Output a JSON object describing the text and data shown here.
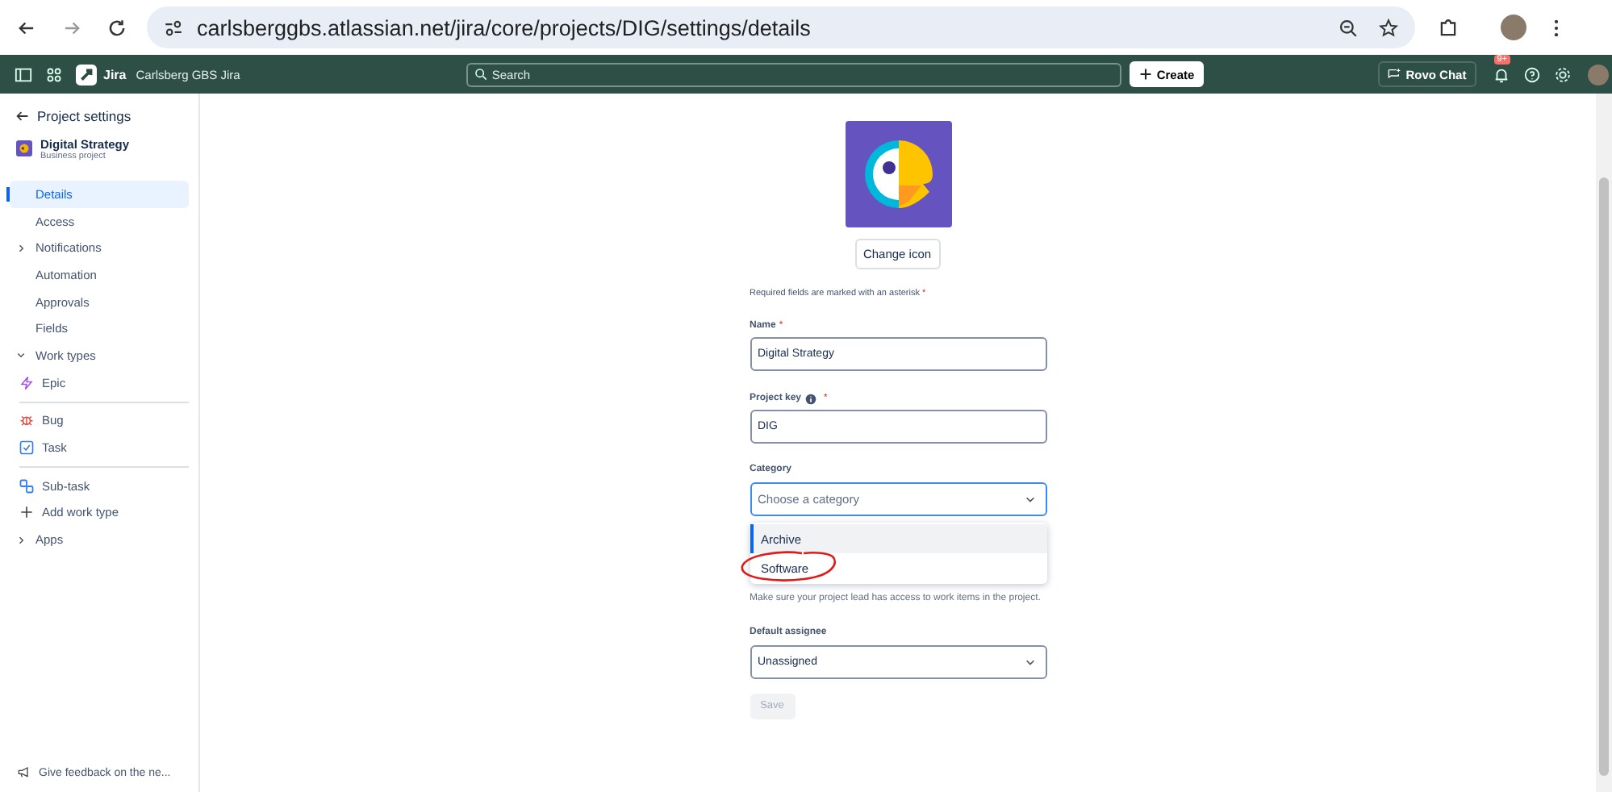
{
  "browser": {
    "url": "carlsberggbs.atlassian.net/jira/core/projects/DIG/settings/details"
  },
  "header": {
    "product": "Jira",
    "site": "Carlsberg GBS Jira",
    "search": {
      "placeholder": "Search"
    },
    "create": "Create",
    "rovo": "Rovo Chat",
    "notification_badge": "9+"
  },
  "sidebar": {
    "back": "Project settings",
    "project": {
      "name": "Digital Strategy",
      "type": "Business project"
    },
    "items": [
      {
        "kind": "link",
        "label": "Details",
        "selected": true
      },
      {
        "kind": "link",
        "label": "Access",
        "selected": false
      },
      {
        "kind": "group",
        "label": "Notifications",
        "expanded": false,
        "selected": false
      },
      {
        "kind": "link",
        "label": "Automation",
        "selected": false
      },
      {
        "kind": "link",
        "label": "Approvals",
        "selected": false
      },
      {
        "kind": "link",
        "label": "Fields",
        "selected": false
      },
      {
        "kind": "group",
        "label": "Work types",
        "expanded": true,
        "selected": false,
        "children": [
          {
            "kind": "epic",
            "label": "Epic",
            "selected": false
          },
          {
            "kind": "divider"
          },
          {
            "kind": "bug",
            "label": "Bug",
            "selected": false
          },
          {
            "kind": "task",
            "label": "Task",
            "selected": false
          },
          {
            "kind": "divider"
          },
          {
            "kind": "subtask",
            "label": "Sub-task",
            "selected": false
          },
          {
            "kind": "add",
            "label": "Add work type",
            "selected": false
          }
        ]
      },
      {
        "kind": "group",
        "label": "Apps",
        "expanded": false,
        "selected": false
      }
    ],
    "feedback": "Give feedback on the ne..."
  },
  "main": {
    "change_icon": "Change icon",
    "required_note": "Required fields are marked with an asterisk",
    "required_note_mark": "*",
    "name": {
      "label": "Name",
      "required_mark": "*",
      "value": "Digital Strategy"
    },
    "project_key": {
      "label": "Project key",
      "required_mark": "*",
      "value": "DIG"
    },
    "category": {
      "label": "Category",
      "placeholder": "Choose a category",
      "focused": true,
      "options": [
        {
          "label": "Archive",
          "selected": true
        },
        {
          "label": "Software",
          "selected": false,
          "circled": true
        }
      ]
    },
    "lead_help": "Make sure your project lead has access to work items in the project.",
    "default_assignee": {
      "label": "Default assignee",
      "value": "Unassigned"
    },
    "save": {
      "label": "Save",
      "disabled": true
    }
  }
}
